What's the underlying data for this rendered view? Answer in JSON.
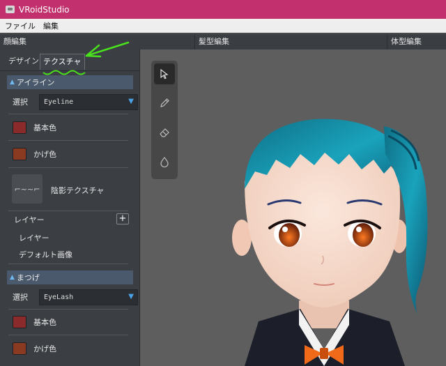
{
  "window": {
    "title": "VRoidStudio"
  },
  "menu": {
    "items": [
      "ファイル",
      "編集"
    ]
  },
  "sections": {
    "face": "顔編集",
    "hair": "髪型編集",
    "body": "体型編集"
  },
  "tabs": {
    "design": "デザイン",
    "texture": "テクスチャ"
  },
  "eyeline": {
    "header": "アイライン",
    "select_label": "選択",
    "select_value": "Eyeline",
    "base_color_label": "基本色",
    "base_color": "#8a2a2a",
    "shade_color_label": "かげ色",
    "shade_color": "#8b3a22",
    "shadow_texture_label": "陰影テクスチャ",
    "shadow_texture_glyph": "⌐~~⌐",
    "layer_header": "レイヤー",
    "layer_item": "レイヤー",
    "default_image": "デフォルト画像"
  },
  "eyelash": {
    "header": "まつげ",
    "select_label": "選択",
    "select_value": "EyeLash",
    "base_color_label": "基本色",
    "base_color": "#8a2a2a",
    "shade_color_label": "かげ色",
    "shade_color": "#8b3a22"
  },
  "tools": [
    "select-icon",
    "pencil-icon",
    "eraser-icon",
    "dropper-icon"
  ],
  "colors": {
    "accent": "#c2306d",
    "annotation": "#49e21d",
    "panel": "#3b3f44",
    "viewport": "#5e5e5e",
    "hair": "#1b8fa6"
  }
}
